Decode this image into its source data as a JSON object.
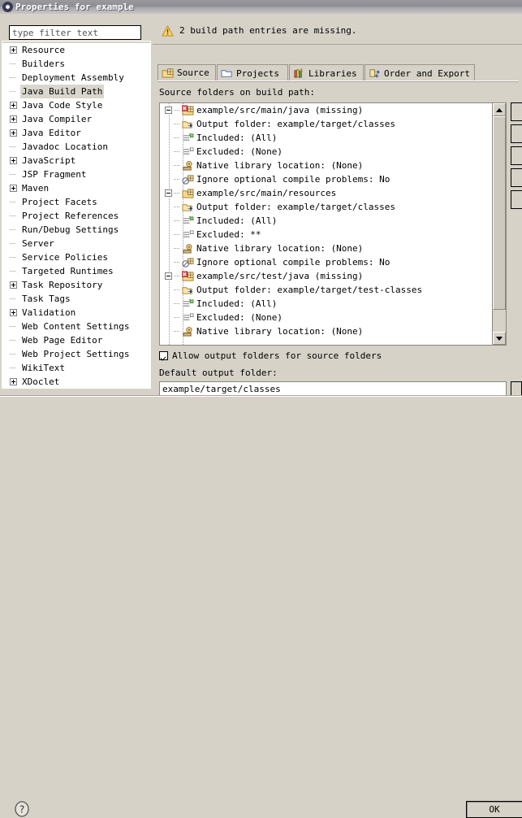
{
  "window": {
    "title": "Properties for example",
    "icon": "gear-icon"
  },
  "filter": {
    "placeholder": "type filter text",
    "value": ""
  },
  "sidebar": {
    "items": [
      {
        "label": "Resource",
        "expandable": true,
        "selected": false
      },
      {
        "label": "Builders",
        "expandable": false,
        "selected": false
      },
      {
        "label": "Deployment Assembly",
        "expandable": false,
        "selected": false
      },
      {
        "label": "Java Build Path",
        "expandable": false,
        "selected": true
      },
      {
        "label": "Java Code Style",
        "expandable": true,
        "selected": false
      },
      {
        "label": "Java Compiler",
        "expandable": true,
        "selected": false
      },
      {
        "label": "Java Editor",
        "expandable": true,
        "selected": false
      },
      {
        "label": "Javadoc Location",
        "expandable": false,
        "selected": false
      },
      {
        "label": "JavaScript",
        "expandable": true,
        "selected": false
      },
      {
        "label": "JSP Fragment",
        "expandable": false,
        "selected": false
      },
      {
        "label": "Maven",
        "expandable": true,
        "selected": false
      },
      {
        "label": "Project Facets",
        "expandable": false,
        "selected": false
      },
      {
        "label": "Project References",
        "expandable": false,
        "selected": false
      },
      {
        "label": "Run/Debug Settings",
        "expandable": false,
        "selected": false
      },
      {
        "label": "Server",
        "expandable": false,
        "selected": false
      },
      {
        "label": "Service Policies",
        "expandable": false,
        "selected": false
      },
      {
        "label": "Targeted Runtimes",
        "expandable": false,
        "selected": false
      },
      {
        "label": "Task Repository",
        "expandable": true,
        "selected": false
      },
      {
        "label": "Task Tags",
        "expandable": false,
        "selected": false
      },
      {
        "label": "Validation",
        "expandable": true,
        "selected": false
      },
      {
        "label": "Web Content Settings",
        "expandable": false,
        "selected": false
      },
      {
        "label": "Web Page Editor",
        "expandable": false,
        "selected": false
      },
      {
        "label": "Web Project Settings",
        "expandable": false,
        "selected": false
      },
      {
        "label": "WikiText",
        "expandable": false,
        "selected": false
      },
      {
        "label": "XDoclet",
        "expandable": true,
        "selected": false
      }
    ]
  },
  "warning": {
    "icon": "warning-triangle-icon",
    "message": "2 build path entries are missing."
  },
  "tabs": [
    {
      "label": "Source",
      "icon": "source-folder-icon",
      "active": true
    },
    {
      "label": "Projects",
      "icon": "projects-folder-icon",
      "active": false
    },
    {
      "label": "Libraries",
      "icon": "libraries-books-icon",
      "active": false
    },
    {
      "label": "Order and Export",
      "icon": "order-export-icon",
      "active": false
    }
  ],
  "main": {
    "tree_label": "Source folders on build path:",
    "tree": [
      {
        "level": 0,
        "icon": "source-folder-error-icon",
        "expanded": true,
        "text": "example/src/main/java (missing)"
      },
      {
        "level": 1,
        "icon": "output-folder-icon",
        "text": "Output folder: example/target/classes"
      },
      {
        "level": 1,
        "icon": "included-filter-icon",
        "text": "Included: (All)"
      },
      {
        "level": 1,
        "icon": "excluded-filter-icon",
        "text": "Excluded: (None)"
      },
      {
        "level": 1,
        "icon": "native-library-icon",
        "text": "Native library location: (None)"
      },
      {
        "level": 1,
        "icon": "ignore-problems-icon",
        "text": "Ignore optional compile problems: No"
      },
      {
        "level": 0,
        "icon": "source-folder-icon",
        "expanded": true,
        "text": "example/src/main/resources"
      },
      {
        "level": 1,
        "icon": "output-folder-icon",
        "text": "Output folder: example/target/classes"
      },
      {
        "level": 1,
        "icon": "included-filter-icon",
        "text": "Included: (All)"
      },
      {
        "level": 1,
        "icon": "excluded-filter-icon",
        "text": "Excluded: **"
      },
      {
        "level": 1,
        "icon": "native-library-icon",
        "text": "Native library location: (None)"
      },
      {
        "level": 1,
        "icon": "ignore-problems-icon",
        "text": "Ignore optional compile problems: No"
      },
      {
        "level": 0,
        "icon": "source-folder-error-icon",
        "expanded": true,
        "text": "example/src/test/java (missing)"
      },
      {
        "level": 1,
        "icon": "output-folder-icon",
        "text": "Output folder: example/target/test-classes"
      },
      {
        "level": 1,
        "icon": "included-filter-icon",
        "text": "Included: (All)"
      },
      {
        "level": 1,
        "icon": "excluded-filter-icon",
        "text": "Excluded: (None)"
      },
      {
        "level": 1,
        "icon": "native-library-icon",
        "text": "Native library location: (None)"
      }
    ],
    "allow_output_folders": {
      "label": "Allow output folders for source folders",
      "checked": true
    },
    "default_output": {
      "label": "Default output folder:",
      "value": "example/target/classes"
    }
  },
  "footer": {
    "help_icon": "help-question-icon",
    "ok_label": "OK"
  },
  "colors": {
    "dialog_bg": "#d6d2c8",
    "field_bg": "#ffffff",
    "selection": "#d9d6cd",
    "warning": "#f0b849",
    "border": "#8d887e"
  }
}
